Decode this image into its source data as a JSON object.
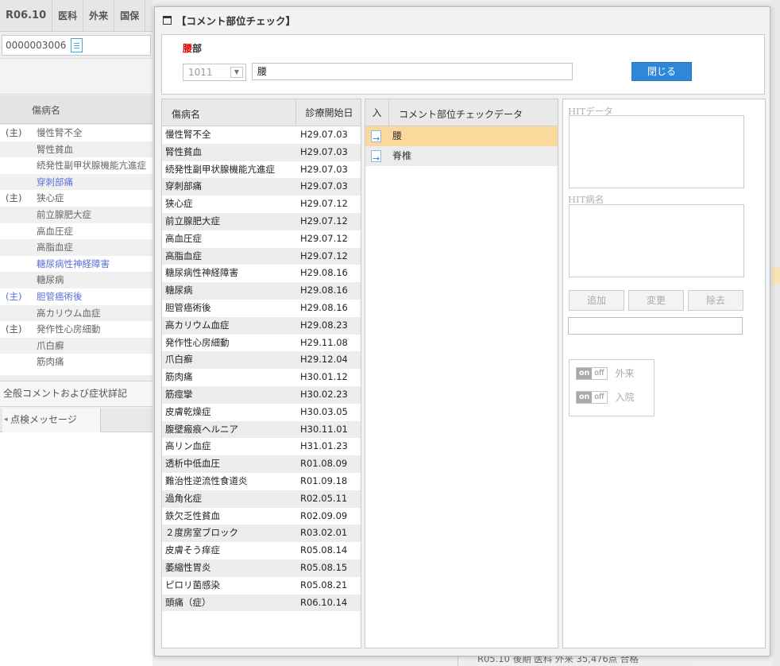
{
  "background": {
    "tabs": [
      "R06.10",
      "医科",
      "外来",
      "国保"
    ],
    "patient_id": "0000003006",
    "dx_header": "傷病名",
    "dx_rows": [
      {
        "mark": "(主)",
        "name": "慢性腎不全",
        "blue": false
      },
      {
        "mark": "",
        "name": "腎性貧血",
        "blue": false
      },
      {
        "mark": "",
        "name": "続発性副甲状腺機能亢進症",
        "blue": false
      },
      {
        "mark": "",
        "name": "穿刺部痛",
        "blue": true
      },
      {
        "mark": "(主)",
        "name": "狭心症",
        "blue": false
      },
      {
        "mark": "",
        "name": "前立腺肥大症",
        "blue": false
      },
      {
        "mark": "",
        "name": "高血圧症",
        "blue": false
      },
      {
        "mark": "",
        "name": "高脂血症",
        "blue": false
      },
      {
        "mark": "",
        "name": "糖尿病性神経障害",
        "blue": true
      },
      {
        "mark": "",
        "name": "糖尿病",
        "blue": false
      },
      {
        "mark": "(主)",
        "name": "胆管癌術後",
        "blue": true
      },
      {
        "mark": "",
        "name": "高カリウム血症",
        "blue": false
      },
      {
        "mark": "(主)",
        "name": "発作性心房細動",
        "blue": false
      },
      {
        "mark": "",
        "name": "爪白癬",
        "blue": false
      },
      {
        "mark": "",
        "name": "筋肉痛",
        "blue": false
      }
    ],
    "comment_section": "全般コメントおよび症状詳記",
    "message_tab": "点検メッセージ",
    "status_bar": "R05.10  後期  医科  外来    35,476点  合格"
  },
  "modal": {
    "title": "【コメント部位チェック】",
    "part_label_red": "腰",
    "part_label_rest": "部",
    "code_value": "1011",
    "part_value": "腰",
    "close_label": "閉じる",
    "dx_table": {
      "col_name": "傷病名",
      "col_date": "診療開始日",
      "rows": [
        {
          "name": "慢性腎不全",
          "date": "H29.07.03"
        },
        {
          "name": "腎性貧血",
          "date": "H29.07.03"
        },
        {
          "name": "続発性副甲状腺機能亢進症",
          "date": "H29.07.03"
        },
        {
          "name": "穿刺部痛",
          "date": "H29.07.03"
        },
        {
          "name": "狭心症",
          "date": "H29.07.12"
        },
        {
          "name": "前立腺肥大症",
          "date": "H29.07.12"
        },
        {
          "name": "高血圧症",
          "date": "H29.07.12"
        },
        {
          "name": "高脂血症",
          "date": "H29.07.12"
        },
        {
          "name": "糖尿病性神経障害",
          "date": "H29.08.16"
        },
        {
          "name": "糖尿病",
          "date": "H29.08.16"
        },
        {
          "name": "胆管癌術後",
          "date": "H29.08.16"
        },
        {
          "name": "高カリウム血症",
          "date": "H29.08.23"
        },
        {
          "name": "発作性心房細動",
          "date": "H29.11.08"
        },
        {
          "name": "爪白癬",
          "date": "H29.12.04"
        },
        {
          "name": "筋肉痛",
          "date": "H30.01.12"
        },
        {
          "name": "筋痙攣",
          "date": "H30.02.23"
        },
        {
          "name": "皮膚乾燥症",
          "date": "H30.03.05"
        },
        {
          "name": "腹壁瘢痕ヘルニア",
          "date": "H30.11.01"
        },
        {
          "name": "高リン血症",
          "date": "H31.01.23"
        },
        {
          "name": "透析中低血圧",
          "date": "R01.08.09"
        },
        {
          "name": "難治性逆流性食道炎",
          "date": "R01.09.18"
        },
        {
          "name": "過角化症",
          "date": "R02.05.11"
        },
        {
          "name": "鉄欠乏性貧血",
          "date": "R02.09.09"
        },
        {
          "name": "２度房室ブロック",
          "date": "R03.02.01"
        },
        {
          "name": "皮膚そう痒症",
          "date": "R05.08.14"
        },
        {
          "name": "萎縮性胃炎",
          "date": "R05.08.15"
        },
        {
          "name": "ピロリ菌感染",
          "date": "R05.08.21"
        },
        {
          "name": "頭痛（症）",
          "date": "R06.10.14"
        }
      ]
    },
    "comment_table": {
      "col_in": "入",
      "col_data": "コメント部位チェックデータ",
      "rows": [
        {
          "text": "腰",
          "selected": true
        },
        {
          "text": "脊椎",
          "selected": false
        }
      ]
    },
    "hit": {
      "data_label": "HITデータ",
      "name_label": "HIT病名",
      "add_label": "追加",
      "change_label": "変更",
      "remove_label": "除去",
      "toggle_on": "on",
      "toggle_off": "off",
      "outpatient_label": "外来",
      "inpatient_label": "入院"
    }
  },
  "colors": {
    "accent_button": "#2f87d9",
    "selected_row": "#fbd99d",
    "part_red": "#e00000",
    "link_blue": "#5a6fd8"
  }
}
